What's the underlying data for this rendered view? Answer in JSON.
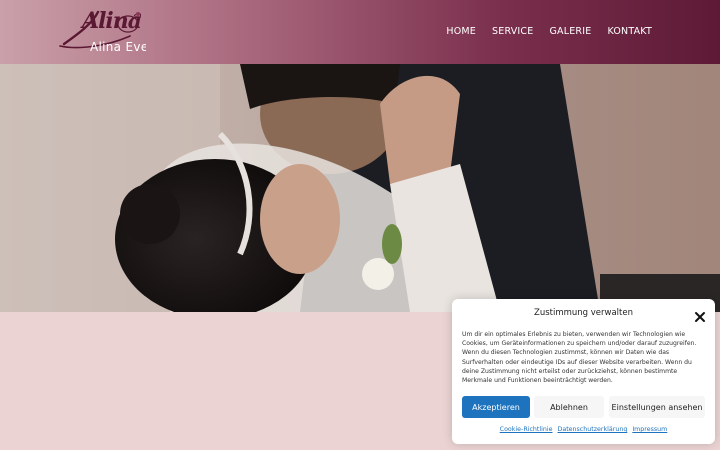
{
  "header": {
    "logo_script": "Alina",
    "logo_text": "Alina Events",
    "nav": [
      "HOME",
      "SERVICE",
      "GALERIE",
      "KONTAKT"
    ]
  },
  "consent": {
    "title": "Zustimmung verwalten",
    "body": "Um dir ein optimales Erlebnis zu bieten, verwenden wir Technologien wie Cookies, um Geräteinformationen zu speichern und/oder darauf zuzugreifen. Wenn du diesen Technologien zustimmst, können wir Daten wie das Surfverhalten oder eindeutige IDs auf dieser Website verarbeiten. Wenn du deine Zustimmung nicht erteilst oder zurückziehst, können bestimmte Merkmale und Funktionen beeinträchtigt werden.",
    "accept_label": "Akzeptieren",
    "deny_label": "Ablehnen",
    "settings_label": "Einstellungen ansehen",
    "links": [
      "Cookie-Richtlinie",
      "Datenschutzerklärung",
      "Impressum"
    ]
  },
  "colors": {
    "header_start": "#caa0a9",
    "header_end": "#5d1a36",
    "page_background": "#ebd3d3",
    "accent_blue": "#1e73be"
  },
  "icons": {
    "close": "close-icon",
    "logo": "logo-icon"
  }
}
